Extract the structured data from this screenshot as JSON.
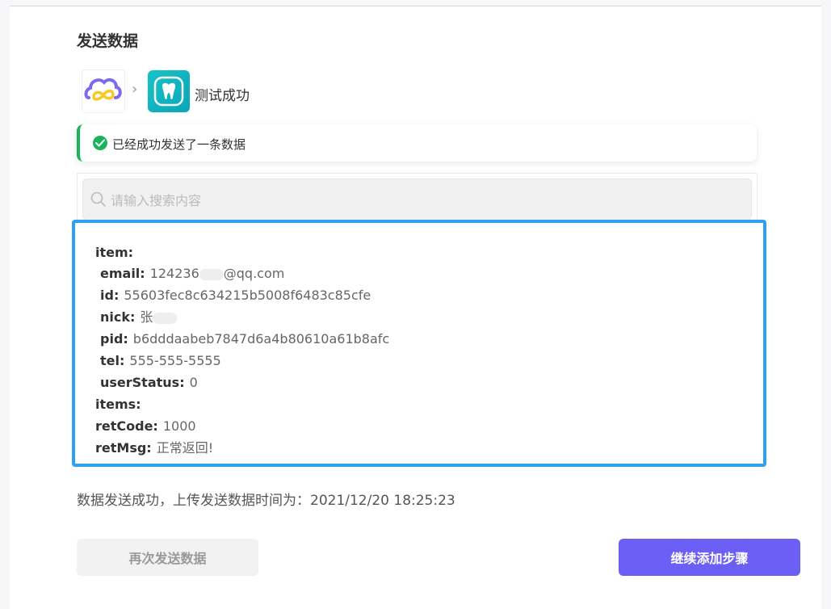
{
  "page": {
    "title": "发送数据"
  },
  "apps": {
    "source_icon": "cloud-infinity-logo",
    "arrow_icon": "chevron-right-icon",
    "target_icon": "tooth-app-logo",
    "status": "测试成功"
  },
  "alert": {
    "icon": "check-circle-icon",
    "text": "已经成功发送了一条数据"
  },
  "search": {
    "placeholder": "请输入搜索内容",
    "value": ""
  },
  "data": {
    "item_key": "item:",
    "fields": [
      {
        "key": "email:",
        "value": "124236",
        "value_suffix": "@qq.com"
      },
      {
        "key": "id:",
        "value": "55603fec8c634215b5008f6483c85cfe"
      },
      {
        "key": "nick:",
        "value": "张"
      },
      {
        "key": "pid:",
        "value": "b6dddaabeb7847d6a4b80610a61b8afc"
      },
      {
        "key": "tel:",
        "value": "555-555-5555"
      },
      {
        "key": "userStatus:",
        "value": "0"
      }
    ],
    "items_key": "items:",
    "retCode_key": "retCode:",
    "retCode_value": "1000",
    "retMsg_key": "retMsg:",
    "retMsg_value": "正常返回!"
  },
  "result": "数据发送成功，上传发送数据时间为：2021/12/20 18:25:23",
  "buttons": {
    "resend": "再次发送数据",
    "continue": "继续添加步骤"
  },
  "colors": {
    "accent": "#6c5ff5",
    "success": "#19b35c",
    "highlight_border": "#2f9fef"
  }
}
